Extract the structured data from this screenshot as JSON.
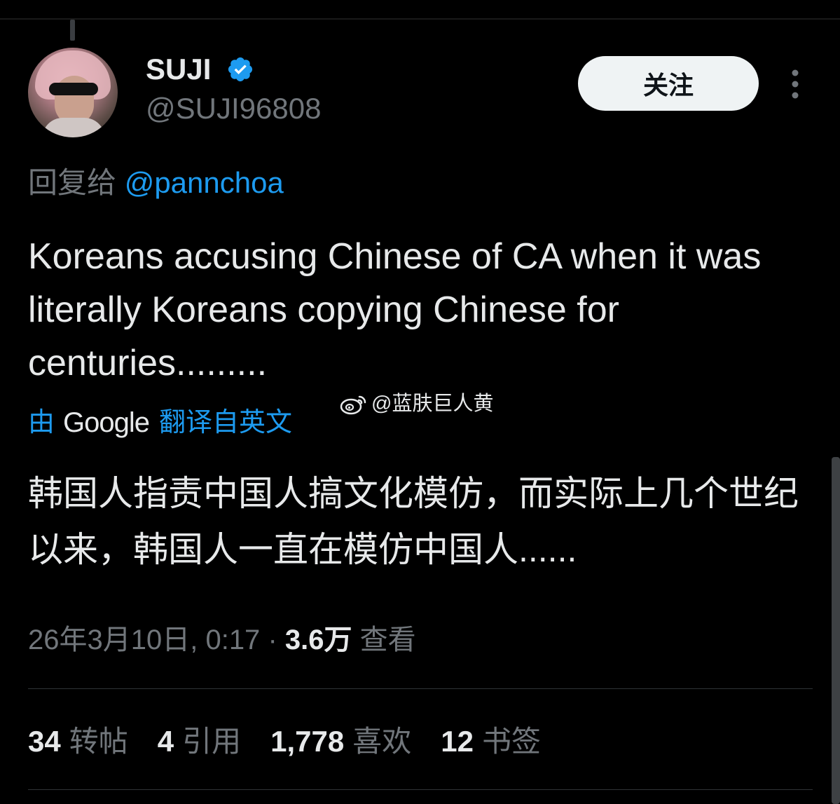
{
  "author": {
    "display_name": "SUJI",
    "handle": "@SUJI96808",
    "verified": true
  },
  "follow_button_label": "关注",
  "reply": {
    "prefix": "回复给",
    "mention": "@pannchoa"
  },
  "tweet": {
    "text": "Koreans accusing Chinese of CA when it was literally Koreans copying Chinese for centuries.........",
    "translation_prefix": "由",
    "translation_brand": "Google",
    "translation_suffix": "翻译自英文",
    "translated_text": "韩国人指责中国人搞文化模仿，而实际上几个世纪以来，韩国人一直在模仿中国人......"
  },
  "watermark": {
    "text": "@蓝肤巨人黄",
    "icon": "weibo-icon"
  },
  "meta": {
    "timestamp": "26年3月10日, 0:17",
    "separator": "·",
    "views_count": "3.6万",
    "views_label": "查看"
  },
  "stats": [
    {
      "count": "34",
      "label": "转帖"
    },
    {
      "count": "4",
      "label": "引用"
    },
    {
      "count": "1,778",
      "label": "喜欢"
    },
    {
      "count": "12",
      "label": "书签"
    }
  ],
  "colors": {
    "background": "#000000",
    "text": "#e7e9ea",
    "secondary": "#71767b",
    "accent": "#1d9bf0",
    "button_bg": "#eff3f4"
  }
}
